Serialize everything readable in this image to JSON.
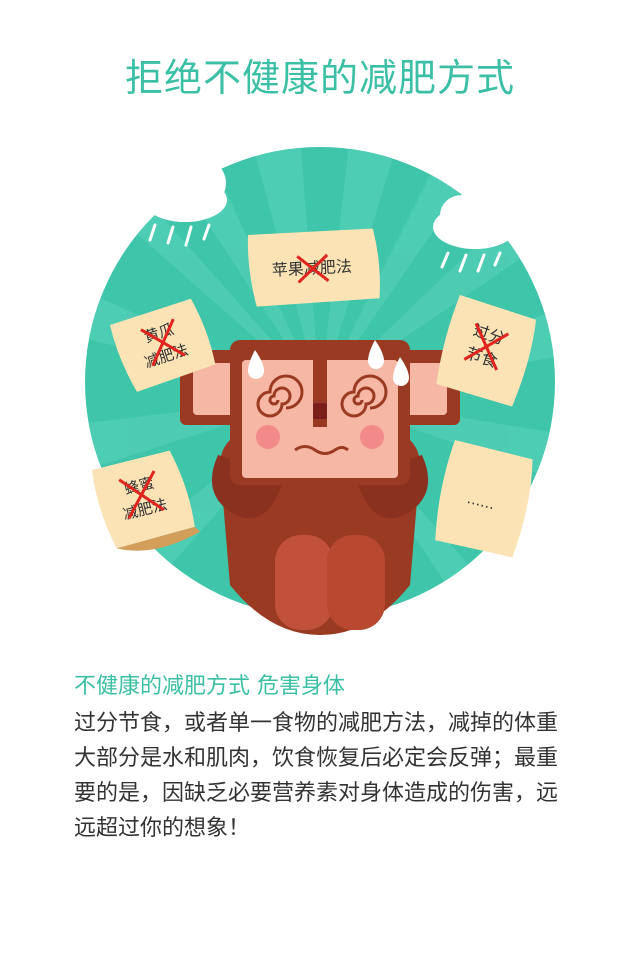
{
  "title": "拒绝不健康的减肥方式",
  "illustration": {
    "papers": [
      {
        "line1": "苹果减肥法"
      },
      {
        "line1": "黄瓜",
        "line2": "减肥法"
      },
      {
        "line1": "过分",
        "line2": "节食"
      },
      {
        "line1": "蜂蜜",
        "line2": "减肥法"
      },
      {
        "line1": "……"
      }
    ],
    "colors": {
      "teal": "#3ec5aa",
      "monkey": "#9a3a22",
      "face": "#f6b7a4",
      "paper": "#fbe3b5",
      "cross": "#e0241f"
    }
  },
  "subtitle": "不健康的减肥方式  危害身体",
  "body": "过分节食，或者单一食物的减肥方法，减掉的体重大部分是水和肌肉，饮食恢复后必定会反弹；最重要的是，因缺乏必要营养素对身体造成的伤害，远远超过你的想象！"
}
